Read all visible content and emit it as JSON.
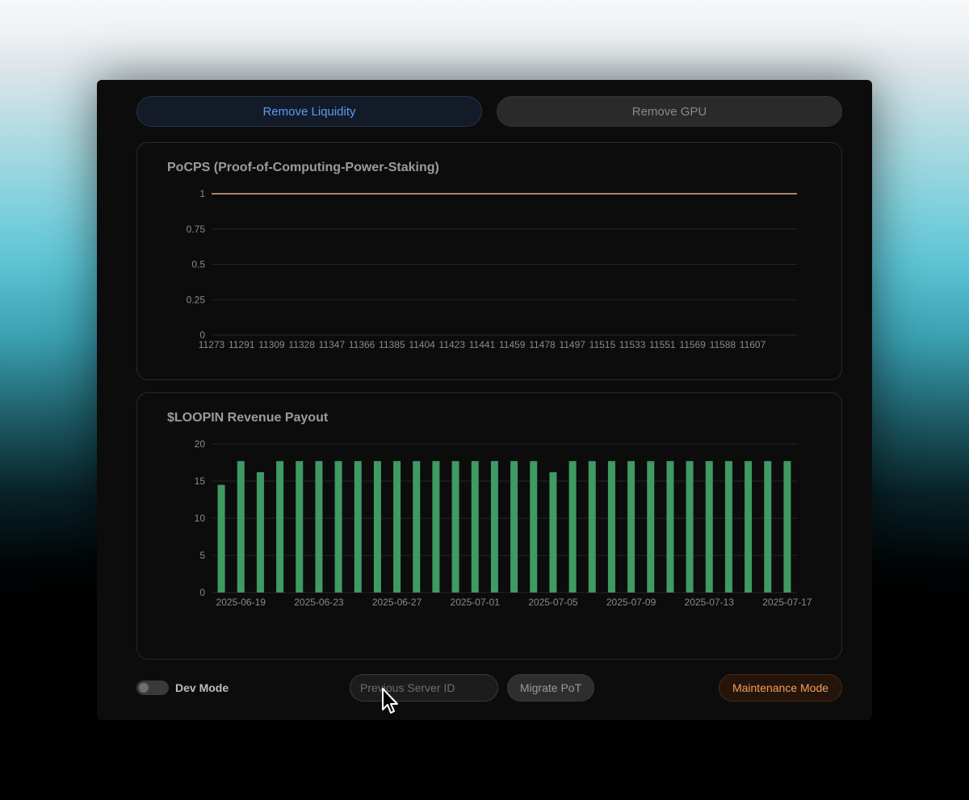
{
  "tabs": [
    {
      "label": "Remove Liquidity",
      "active": true
    },
    {
      "label": "Remove GPU",
      "active": false
    }
  ],
  "pocps_card": {
    "title": "PoCPS (Proof-of-Computing-Power-Staking)"
  },
  "revenue_card": {
    "title": "$LOOPIN Revenue Payout"
  },
  "footer": {
    "dev_mode_label": "Dev Mode",
    "dev_mode_on": false,
    "server_id_placeholder": "Previous Server ID",
    "migrate_label": "Migrate PoT",
    "maintenance_label": "Maintenance Mode"
  },
  "icons": [
    "mouse-cursor-icon"
  ],
  "colors": {
    "accent_blue": "#5b9cf1",
    "line_series": "#e8a68a",
    "bar_series": "#3f9a63",
    "maintenance": "#f0a060"
  },
  "chart_data": [
    {
      "type": "line",
      "title": "PoCPS (Proof-of-Computing-Power-Staking)",
      "x_ticks": [
        "11273",
        "11291",
        "11309",
        "11328",
        "11347",
        "11366",
        "11385",
        "11404",
        "11423",
        "11441",
        "11459",
        "11478",
        "11497",
        "11515",
        "11533",
        "11551",
        "11569",
        "11588",
        "11607"
      ],
      "x_range": [
        11273,
        11645
      ],
      "y_ticks": [
        "0",
        "0.25",
        "0.5",
        "0.75",
        "1"
      ],
      "ylim": [
        0,
        1
      ],
      "series": [
        {
          "x": [
            11273,
            11645
          ],
          "values": [
            1,
            1
          ]
        }
      ],
      "grid": "horizontal",
      "xlabel": "",
      "ylabel": ""
    },
    {
      "type": "bar",
      "title": "$LOOPIN Revenue Payout",
      "categories": [
        "2025-06-18",
        "2025-06-19",
        "2025-06-20",
        "2025-06-21",
        "2025-06-22",
        "2025-06-23",
        "2025-06-24",
        "2025-06-25",
        "2025-06-26",
        "2025-06-27",
        "2025-06-28",
        "2025-06-29",
        "2025-06-30",
        "2025-07-01",
        "2025-07-02",
        "2025-07-03",
        "2025-07-04",
        "2025-07-05",
        "2025-07-06",
        "2025-07-07",
        "2025-07-08",
        "2025-07-09",
        "2025-07-10",
        "2025-07-11",
        "2025-07-12",
        "2025-07-13",
        "2025-07-14",
        "2025-07-15",
        "2025-07-16",
        "2025-07-17"
      ],
      "x_tick_labels": [
        "2025-06-19",
        "2025-06-23",
        "2025-06-27",
        "2025-07-01",
        "2025-07-05",
        "2025-07-09",
        "2025-07-13",
        "2025-07-17"
      ],
      "values": [
        14.5,
        17.7,
        16.2,
        17.7,
        17.7,
        17.7,
        17.7,
        17.7,
        17.7,
        17.7,
        17.7,
        17.7,
        17.7,
        17.7,
        17.7,
        17.7,
        17.7,
        16.2,
        17.7,
        17.7,
        17.7,
        17.7,
        17.7,
        17.7,
        17.7,
        17.7,
        17.7,
        17.7,
        17.7,
        17.7
      ],
      "y_ticks": [
        "0",
        "5",
        "10",
        "15",
        "20"
      ],
      "ylim": [
        0,
        20
      ],
      "grid": "horizontal",
      "xlabel": "",
      "ylabel": ""
    }
  ]
}
